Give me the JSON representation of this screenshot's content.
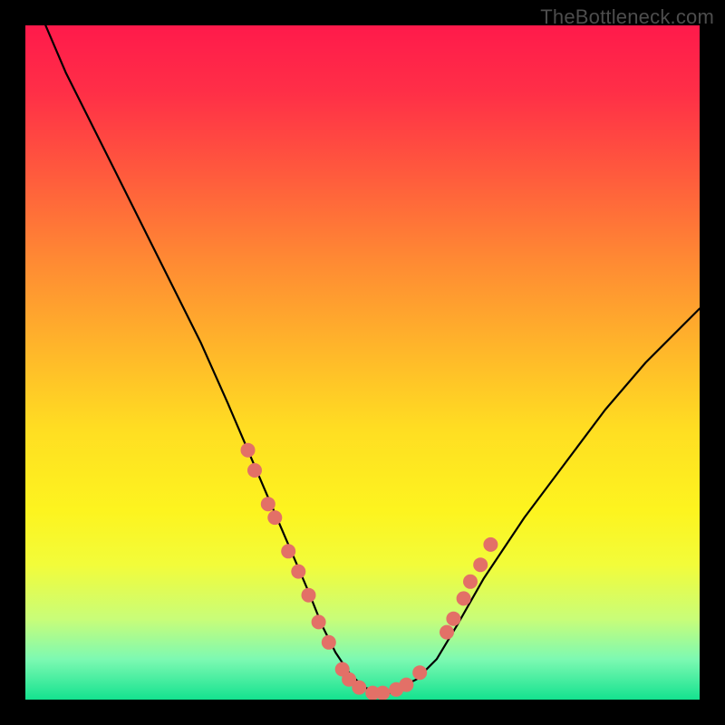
{
  "watermark": "TheBottleneck.com",
  "colors": {
    "background": "#000000",
    "curve": "#000000",
    "dots": "#e37067",
    "gradient_top": "#ff1a4b",
    "gradient_bottom": "#14e28f"
  },
  "chart_data": {
    "type": "line",
    "title": "",
    "xlabel": "",
    "ylabel": "",
    "xlim": [
      0,
      100
    ],
    "ylim": [
      0,
      100
    ],
    "grid": false,
    "series": [
      {
        "name": "bottleneck-curve",
        "x": [
          3,
          6,
          10,
          14,
          18,
          22,
          26,
          30,
          33,
          36,
          39,
          42,
          44,
          46,
          48,
          50,
          52,
          54,
          56,
          58,
          61,
          64,
          68,
          74,
          80,
          86,
          92,
          98,
          100
        ],
        "y": [
          100,
          93,
          85,
          77,
          69,
          61,
          53,
          44,
          37,
          30,
          23,
          16,
          11,
          7,
          4,
          2,
          1,
          1,
          2,
          3,
          6,
          11,
          18,
          27,
          35,
          43,
          50,
          56,
          58
        ]
      }
    ],
    "highlight_dots": [
      {
        "x": 33,
        "y": 37
      },
      {
        "x": 34,
        "y": 34
      },
      {
        "x": 36,
        "y": 29
      },
      {
        "x": 37,
        "y": 27
      },
      {
        "x": 39,
        "y": 22
      },
      {
        "x": 40.5,
        "y": 19
      },
      {
        "x": 42,
        "y": 15.5
      },
      {
        "x": 43.5,
        "y": 11.5
      },
      {
        "x": 45,
        "y": 8.5
      },
      {
        "x": 47,
        "y": 4.5
      },
      {
        "x": 48,
        "y": 3
      },
      {
        "x": 49.5,
        "y": 1.8
      },
      {
        "x": 51.5,
        "y": 1
      },
      {
        "x": 53,
        "y": 1
      },
      {
        "x": 55,
        "y": 1.5
      },
      {
        "x": 56.5,
        "y": 2.2
      },
      {
        "x": 58.5,
        "y": 4
      },
      {
        "x": 62.5,
        "y": 10
      },
      {
        "x": 63.5,
        "y": 12
      },
      {
        "x": 65,
        "y": 15
      },
      {
        "x": 66,
        "y": 17.5
      },
      {
        "x": 67.5,
        "y": 20
      },
      {
        "x": 69,
        "y": 23
      }
    ]
  }
}
